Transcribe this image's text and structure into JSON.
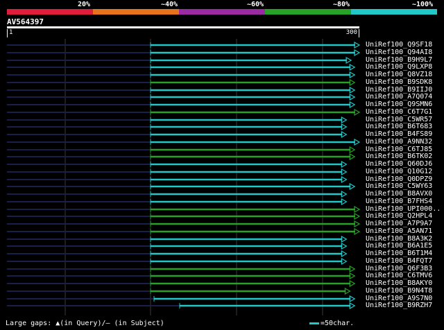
{
  "scale": {
    "labels": [
      "20%",
      "~40%",
      "~60%",
      "~80%",
      "~100%"
    ],
    "colors": [
      "#e01e3c",
      "#e8731e",
      "#9b2ba3",
      "#27a227",
      "#22c8c8"
    ]
  },
  "query": {
    "id": "AV564397",
    "start_label": "1",
    "end_label": "300"
  },
  "colors": {
    "cyan": "#22c8c8",
    "green": "#27a227",
    "gray_tail": "#1a1f4a",
    "grid": "#3a3a3a"
  },
  "hits": [
    {
      "label": "UniRef100_Q9SF18",
      "color": "cyan",
      "end": 300
    },
    {
      "label": "UniRef100_Q94AI8",
      "color": "cyan",
      "end": 300
    },
    {
      "label": "UniRef100_B9H9L7",
      "color": "cyan",
      "end": 293
    },
    {
      "label": "UniRef100_Q9LXP8",
      "color": "cyan",
      "end": 296
    },
    {
      "label": "UniRef100_Q8VZ18",
      "color": "cyan",
      "end": 296
    },
    {
      "label": "UniRef100_B9SDK8",
      "color": "green",
      "end": 296
    },
    {
      "label": "UniRef100_B9IIJ0",
      "color": "cyan",
      "end": 296
    },
    {
      "label": "UniRef100_A7Q074",
      "color": "cyan",
      "end": 296
    },
    {
      "label": "UniRef100_Q9SMN6",
      "color": "cyan",
      "end": 296
    },
    {
      "label": "UniRef100_C6T7G1",
      "color": "green",
      "end": 300
    },
    {
      "label": "UniRef100_C5WR57",
      "color": "cyan",
      "end": 289
    },
    {
      "label": "UniRef100_B6T683",
      "color": "cyan",
      "end": 289
    },
    {
      "label": "UniRef100_B4FS89",
      "color": "cyan",
      "end": 289
    },
    {
      "label": "UniRef100_A9NN32",
      "color": "cyan",
      "end": 300
    },
    {
      "label": "UniRef100_C6TJ85",
      "color": "green",
      "end": 296
    },
    {
      "label": "UniRef100_B6TK02",
      "color": "green",
      "end": 296
    },
    {
      "label": "UniRef100_Q60DJ6",
      "color": "cyan",
      "end": 289
    },
    {
      "label": "UniRef100_Q10G12",
      "color": "cyan",
      "end": 289
    },
    {
      "label": "UniRef100_Q0DPZ9",
      "color": "cyan",
      "end": 289
    },
    {
      "label": "UniRef100_C5WY63",
      "color": "cyan",
      "end": 296
    },
    {
      "label": "UniRef100_B8AVX0",
      "color": "cyan",
      "end": 289
    },
    {
      "label": "UniRef100_B7FHS4",
      "color": "cyan",
      "end": 289
    },
    {
      "label": "UniRef100_UPI000..",
      "color": "green",
      "end": 300
    },
    {
      "label": "UniRef100_Q2HPL4",
      "color": "green",
      "end": 300
    },
    {
      "label": "UniRef100_A7P9A7",
      "color": "green",
      "end": 300
    },
    {
      "label": "UniRef100_A5AN71",
      "color": "green",
      "end": 300
    },
    {
      "label": "UniRef100_B8A3K2",
      "color": "cyan",
      "end": 289
    },
    {
      "label": "UniRef100_B6A1E5",
      "color": "cyan",
      "end": 289
    },
    {
      "label": "UniRef100_B6T1M4",
      "color": "cyan",
      "end": 289
    },
    {
      "label": "UniRef100_B4FQT7",
      "color": "cyan",
      "end": 289
    },
    {
      "label": "UniRef100_Q6F3B3",
      "color": "green",
      "end": 296
    },
    {
      "label": "UniRef100_C6TMV6",
      "color": "green",
      "end": 296
    },
    {
      "label": "UniRef100_B8AKY0",
      "color": "green",
      "end": 296
    },
    {
      "label": "UniRef100_B9N4T8",
      "color": "green",
      "end": 292
    },
    {
      "label": "UniRef100_A9S7N0",
      "color": "cyan",
      "end": 296
    },
    {
      "label": "UniRef100_B9RZH7",
      "color": "cyan",
      "end": 296
    }
  ],
  "footer": {
    "gaps_text": "Large gaps: ▲(in Query)/– (in Subject)",
    "legend_text": "=50char."
  }
}
